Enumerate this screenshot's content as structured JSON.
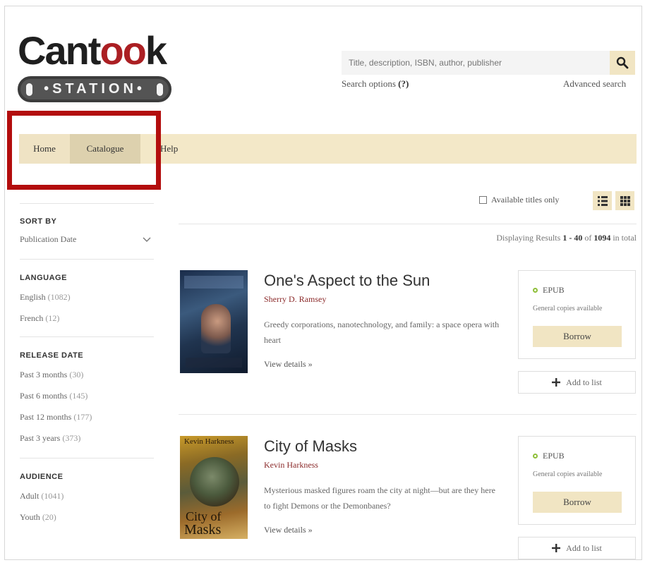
{
  "logo": {
    "word_start": "Cant",
    "word_oo": "oo",
    "word_end": "k",
    "station": "•STATION•"
  },
  "search": {
    "placeholder": "Title, description, ISBN, author, publisher",
    "options_label": "Search options",
    "options_help": "(?)",
    "advanced": "Advanced search",
    "icon": "search-icon"
  },
  "nav": {
    "home": "Home",
    "catalogue": "Catalogue",
    "help": "Help"
  },
  "sidebar": {
    "sort": {
      "heading": "SORT BY",
      "selected": "Publication Date"
    },
    "language": {
      "heading": "LANGUAGE",
      "items": [
        {
          "label": "English",
          "count": "(1082)"
        },
        {
          "label": "French",
          "count": "(12)"
        }
      ]
    },
    "release": {
      "heading": "RELEASE DATE",
      "items": [
        {
          "label": "Past 3 months",
          "count": "(30)"
        },
        {
          "label": "Past 6 months",
          "count": "(145)"
        },
        {
          "label": "Past 12 months",
          "count": "(177)"
        },
        {
          "label": "Past 3 years",
          "count": "(373)"
        }
      ]
    },
    "audience": {
      "heading": "AUDIENCE",
      "items": [
        {
          "label": "Adult",
          "count": "(1041)"
        },
        {
          "label": "Youth",
          "count": "(20)"
        }
      ]
    }
  },
  "toolbar": {
    "available_only": "Available titles only",
    "list_view_icon": "list-view-icon",
    "grid_view_icon": "grid-view-icon"
  },
  "results": {
    "prefix": "Displaying Results",
    "range": "1 - 40",
    "of": "of",
    "total": "1094",
    "suffix": "in total"
  },
  "books": [
    {
      "title": "One's Aspect to the Sun",
      "author": "Sherry D. Ramsey",
      "description": "Greedy corporations, nanotechnology, and family: a space opera with heart",
      "details": "View details »",
      "format": "EPUB",
      "copies": "General copies available",
      "borrow": "Borrow",
      "add": "Add to list"
    },
    {
      "title": "City of Masks",
      "author": "Kevin Harkness",
      "description": "Mysterious masked figures roam the city at night—but are they here to fight Demons or the Demonbanes?",
      "details": "View details »",
      "format": "EPUB",
      "copies": "General copies available",
      "borrow": "Borrow",
      "add": "Add to list",
      "cover_author": "Kevin Harkness",
      "cover_title_1": "City of",
      "cover_title_2": "Masks"
    }
  ],
  "colors": {
    "accent": "#f1e5c3",
    "nav_bar": "#f3e8c8",
    "highlight": "#b30d0d",
    "author": "#8b2a2a",
    "available_dot": "#8fbf3a"
  }
}
